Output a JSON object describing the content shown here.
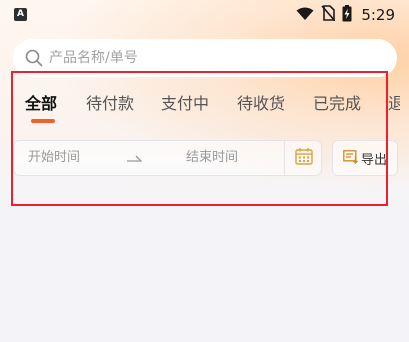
{
  "status_bar": {
    "app_icon_letter": "A",
    "time": "5:29"
  },
  "search": {
    "placeholder": "产品名称/单号",
    "value": ""
  },
  "tabs": [
    {
      "label": "全部",
      "active": true
    },
    {
      "label": "待付款",
      "active": false
    },
    {
      "label": "支付中",
      "active": false
    },
    {
      "label": "待收货",
      "active": false
    },
    {
      "label": "已完成",
      "active": false
    },
    {
      "label": "退",
      "active": false
    }
  ],
  "date_range": {
    "start_placeholder": "开始时间",
    "end_placeholder": "结束时间"
  },
  "export": {
    "label": "导出"
  },
  "colors": {
    "accent": "#f0622a",
    "highlight": "#e8232d",
    "calendar_icon": "#e0a23a"
  }
}
